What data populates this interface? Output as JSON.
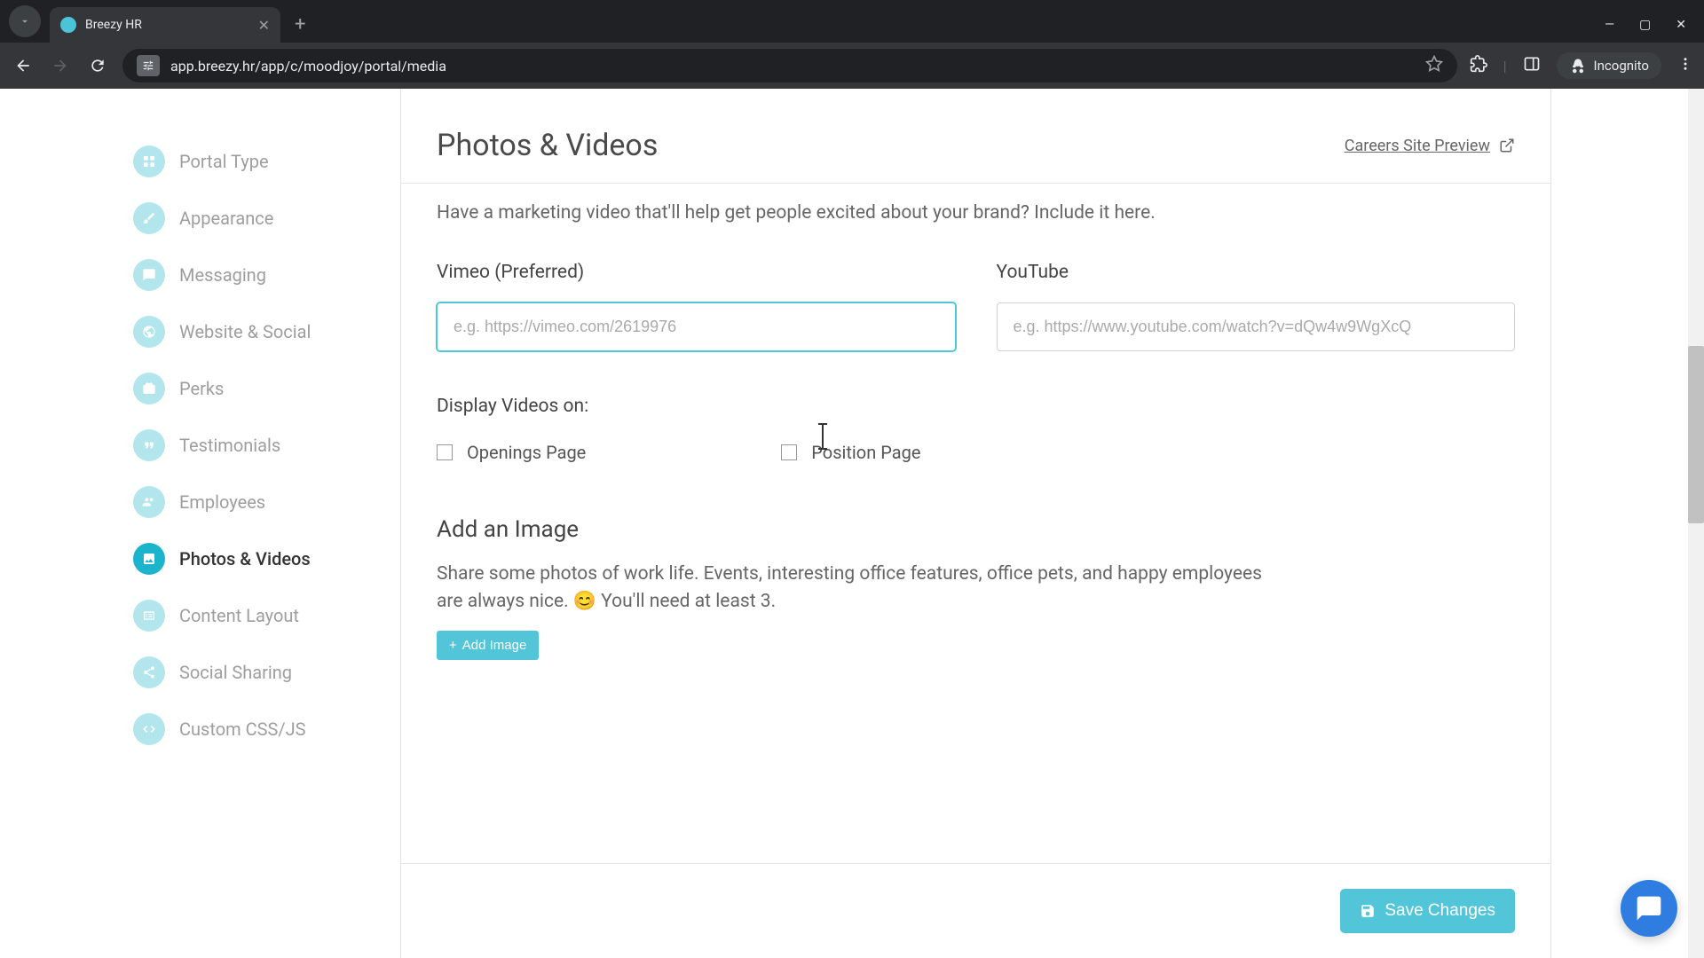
{
  "browser": {
    "tab_title": "Breezy HR",
    "url": "app.breezy.hr/app/c/moodjoy/portal/media",
    "incognito_label": "Incognito"
  },
  "sidebar": {
    "items": [
      {
        "label": "Portal Type",
        "icon": "grid"
      },
      {
        "label": "Appearance",
        "icon": "brush"
      },
      {
        "label": "Messaging",
        "icon": "message"
      },
      {
        "label": "Website & Social",
        "icon": "globe"
      },
      {
        "label": "Perks",
        "icon": "gift"
      },
      {
        "label": "Testimonials",
        "icon": "quote"
      },
      {
        "label": "Employees",
        "icon": "users"
      },
      {
        "label": "Photos & Videos",
        "icon": "image",
        "active": true
      },
      {
        "label": "Content Layout",
        "icon": "layout"
      },
      {
        "label": "Social Sharing",
        "icon": "share"
      },
      {
        "label": "Custom CSS/JS",
        "icon": "code"
      }
    ]
  },
  "header": {
    "title": "Photos & Videos",
    "preview_link": "Careers Site Preview"
  },
  "main": {
    "intro": "Have a marketing video that'll help get people excited about your brand? Include it here.",
    "vimeo_label": "Vimeo (Preferred)",
    "vimeo_placeholder": "e.g. https://vimeo.com/2619976",
    "vimeo_value": "",
    "youtube_label": "YouTube",
    "youtube_placeholder": "e.g. https://www.youtube.com/watch?v=dQw4w9WgXcQ",
    "youtube_value": "",
    "display_label": "Display Videos on:",
    "checkbox_openings": "Openings Page",
    "checkbox_position": "Position Page",
    "add_image_heading": "Add an Image",
    "add_image_text": "Share some photos of work life. Events, interesting office features, office pets, and happy employees are always nice. 😊 You'll need at least 3.",
    "add_image_button": "Add Image"
  },
  "footer": {
    "save_label": "Save Changes"
  }
}
